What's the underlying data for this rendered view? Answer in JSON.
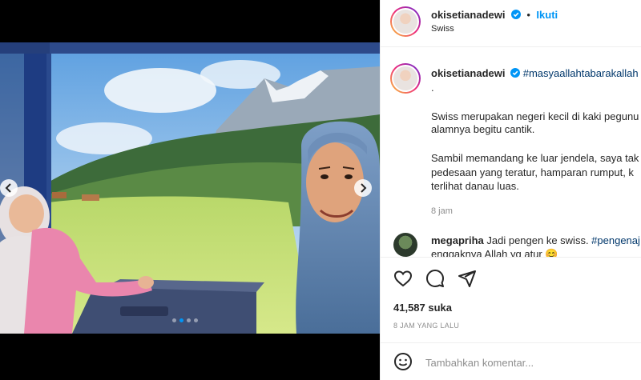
{
  "post": {
    "username": "okisetianadewi",
    "follow_label": "Ikuti",
    "separator": "•",
    "location": "Swiss"
  },
  "caption": {
    "username": "okisetianadewi",
    "hashtag": "#masyaallahtabarakallah",
    "dot_line": ".",
    "line1": "Swiss merupakan negeri kecil di kaki pegunu",
    "line2": "alamnya begitu cantik.",
    "line3": "Sambil memandang ke luar jendela, saya tak",
    "line4": "pedesaan yang teratur, hamparan rumput, k",
    "line5": "terlihat danau luas.",
    "age": "8 jam"
  },
  "comments": [
    {
      "username": "megapriha",
      "text_part1": "Jadi pengen ke swiss. ",
      "hashtag": "#pengenaj",
      "text_line2": "enggaknya Allah yg atur 😊"
    }
  ],
  "actions": {
    "icons": [
      "heart-icon",
      "comment-icon",
      "share-icon"
    ]
  },
  "likes_text": "41,587 suka",
  "timestamp": "8 JAM YANG LALU",
  "comment_box": {
    "placeholder": "Tambahkan komentar...",
    "emoji_icon": "emoji-icon"
  },
  "carousel": {
    "total_slides": 4,
    "active_slide": 2
  },
  "colors": {
    "accent": "#0095f6",
    "hashtag": "#00376b",
    "muted": "#8e8e8e"
  }
}
